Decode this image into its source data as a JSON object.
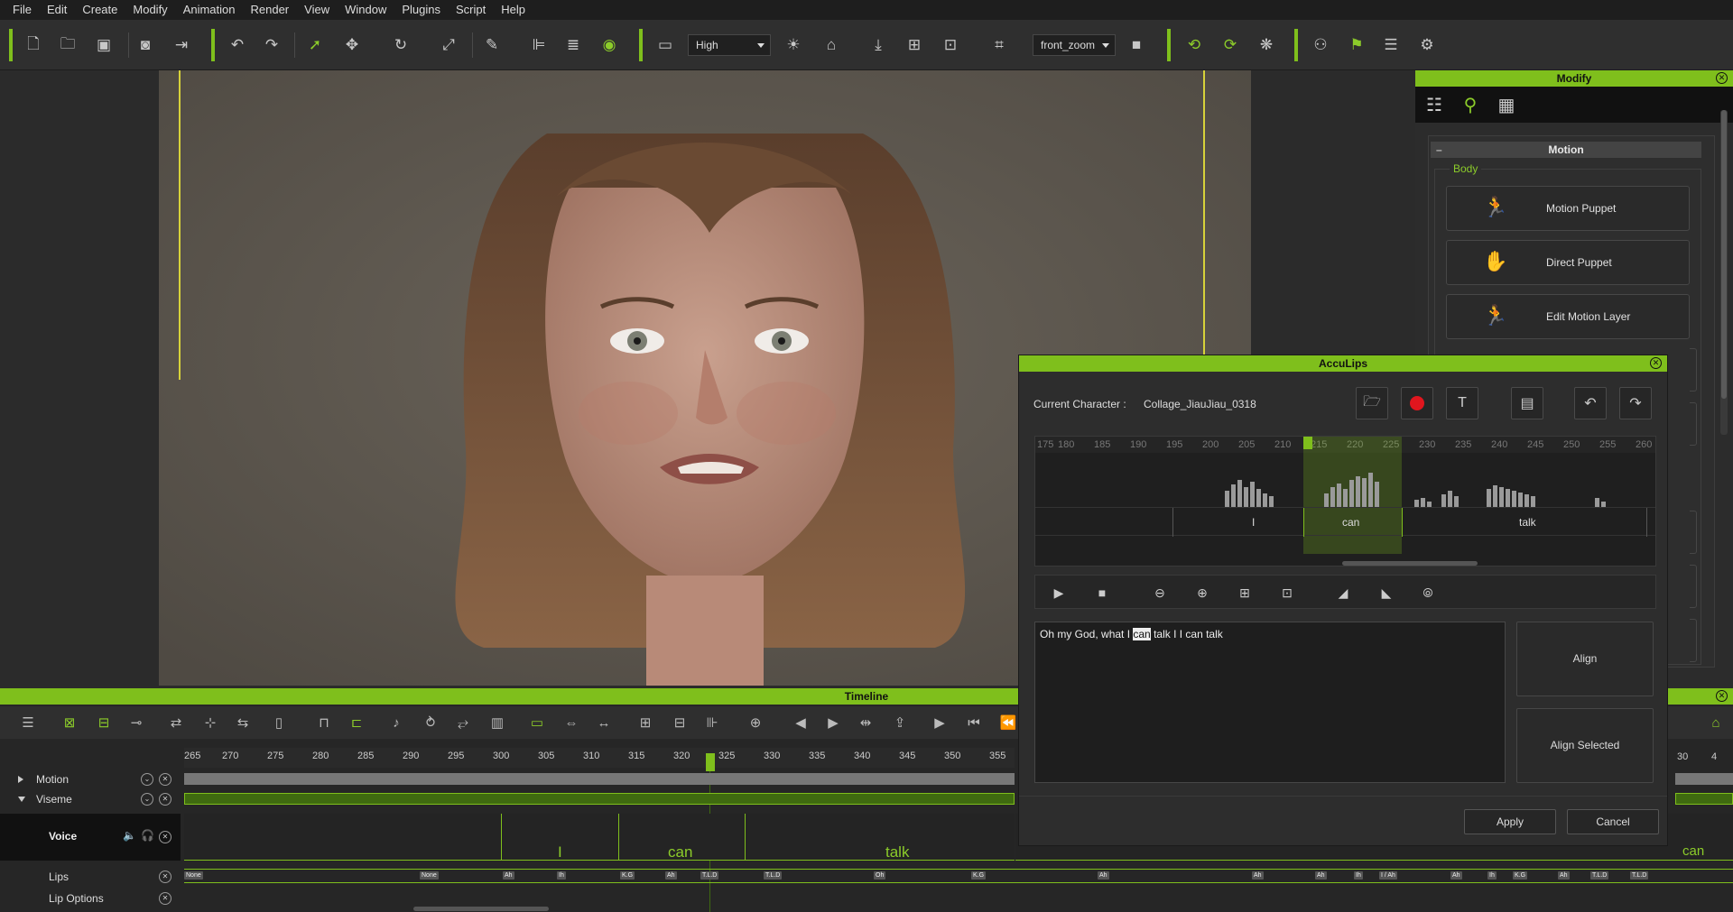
{
  "menu": [
    "File",
    "Edit",
    "Create",
    "Modify",
    "Animation",
    "Render",
    "View",
    "Window",
    "Plugins",
    "Script",
    "Help"
  ],
  "toolbar": {
    "quality": "High",
    "camera": "front_zoom"
  },
  "modify": {
    "title": "Modify",
    "section": "Motion",
    "group": "Body",
    "buttons": [
      "Motion Puppet",
      "Direct Puppet",
      "Edit Motion Layer"
    ]
  },
  "timeline": {
    "title": "Timeline",
    "ruler": [
      "265",
      "270",
      "275",
      "280",
      "285",
      "290",
      "295",
      "300",
      "305",
      "310",
      "315",
      "320",
      "325",
      "330",
      "335",
      "340",
      "345",
      "350",
      "355"
    ],
    "tracks": {
      "motion": "Motion",
      "viseme": "Viseme",
      "voice": "Voice",
      "lips": "Lips",
      "lip_options": "Lip Options"
    },
    "words": [
      "I",
      "can",
      "talk"
    ],
    "right_word": "can",
    "right_ruler": [
      "30",
      "4"
    ],
    "visemes": [
      "None",
      "None",
      "Ah",
      "Ih",
      "K.G",
      "Ah",
      "T.L.D",
      "T.L.D",
      "Oh",
      "K.G",
      "Ah",
      "Ah",
      "Ah",
      "Ih",
      "I / Ah",
      "Ah",
      "Ih",
      "K.G",
      "Ah",
      "T.L.D",
      "T.L.D"
    ]
  },
  "acculips": {
    "title": "AccuLips",
    "current_character_label": "Current Character :",
    "current_character": "Collage_JiauJiau_0318",
    "wave_ruler": [
      "175",
      "180",
      "185",
      "190",
      "195",
      "200",
      "205",
      "210",
      "215",
      "220",
      "225",
      "230",
      "235",
      "240",
      "245",
      "250",
      "255",
      "260"
    ],
    "wave_words": [
      "I",
      "can",
      "talk"
    ],
    "text_before": "Oh my God, what I ",
    "text_highlight": "can",
    "text_after": " talk I I can talk",
    "align": "Align",
    "align_selected": "Align Selected",
    "apply": "Apply",
    "cancel": "Cancel"
  },
  "colors": {
    "accent": "#7fbf1c",
    "record": "#e0161e",
    "panel": "#2d2d2d"
  },
  "icons": [
    "new-file-icon",
    "open-folder-icon",
    "save-icon",
    "undo-icon",
    "redo-icon",
    "select-arrow-icon",
    "move-icon",
    "rotate-icon",
    "scale-icon",
    "eye-icon",
    "sun-icon",
    "home-icon",
    "camera-icon",
    "flag-icon",
    "play-icon",
    "stop-icon",
    "zoom-in-icon",
    "zoom-out-icon",
    "record-icon",
    "close-icon"
  ]
}
